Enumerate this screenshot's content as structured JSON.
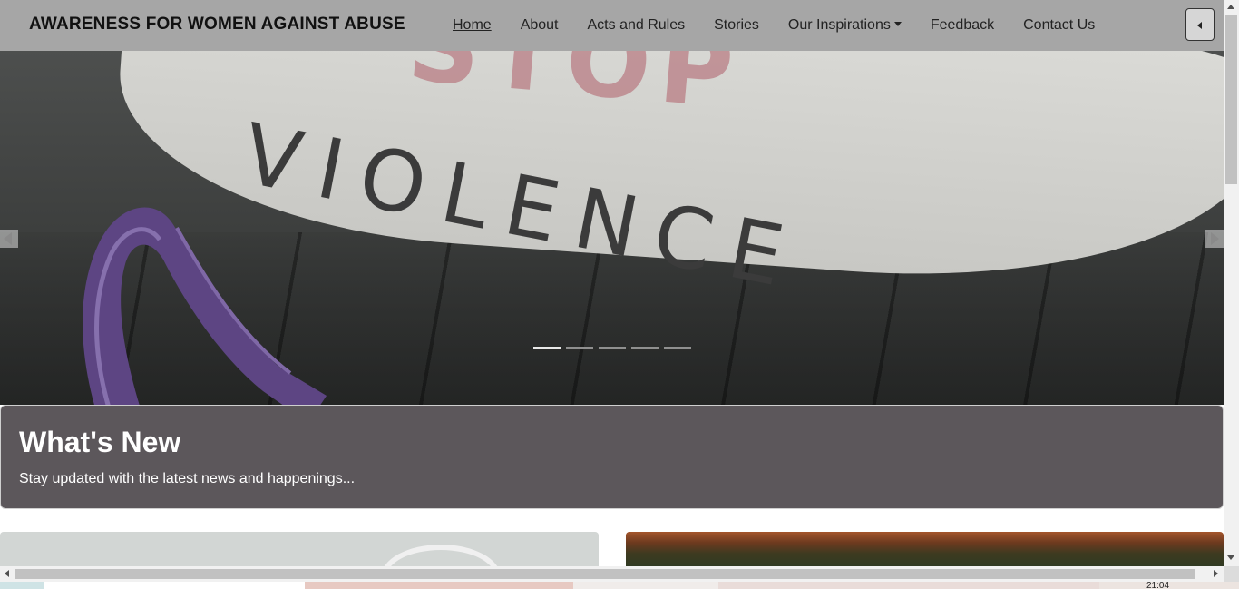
{
  "navbar": {
    "brand": "AWARENESS FOR WOMEN AGAINST ABUSE",
    "links": [
      {
        "label": "Home",
        "active": true
      },
      {
        "label": "About"
      },
      {
        "label": "Acts and Rules"
      },
      {
        "label": "Stories"
      },
      {
        "label": "Our Inspirations",
        "dropdown": true
      },
      {
        "label": "Feedback"
      },
      {
        "label": "Contact Us"
      }
    ],
    "toggle_icon": "caret-left-icon"
  },
  "hero": {
    "image_word_top": "STOP",
    "image_word": "VIOLENCE",
    "slides_total": 5,
    "active_slide": 1,
    "colors": {
      "ribbon": "#6a4f8f",
      "paper": "#d4d4d0"
    }
  },
  "news": {
    "title": "What's New",
    "subtitle": "Stay updated with the latest news and happenings..."
  },
  "taskbar": {
    "clock": "21:04"
  }
}
